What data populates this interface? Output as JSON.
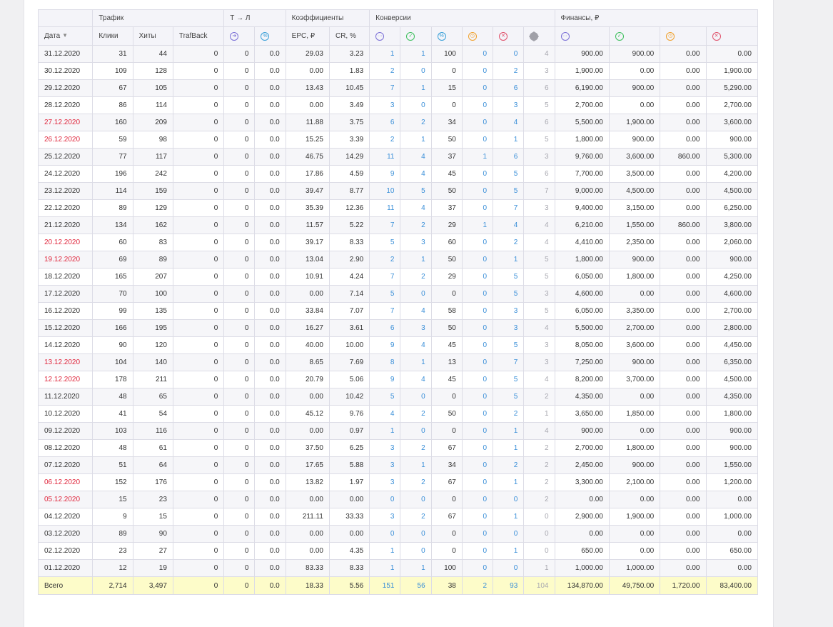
{
  "groups": {
    "traffic": "Трафик",
    "tl": "Т → Л",
    "coef": "Коэффициенты",
    "conv": "Конверсии",
    "fin": "Финансы, ₽"
  },
  "columns": {
    "date": "Дата",
    "clicks": "Клики",
    "hits": "Хиты",
    "trafback": "TrafBack",
    "epc": "EPC, ₽",
    "cr": "CR, %"
  },
  "icons": {
    "tl_arrow": "arrow-right-circle-icon",
    "tl_percent": "percent-circle-icon",
    "conv_all": "dots-circle-icon",
    "conv_approved": "check-circle-icon",
    "conv_percent": "percent-circle-icon",
    "conv_hold": "clock-circle-icon",
    "conv_rejected": "x-circle-icon",
    "conv_trash": "slash-circle-icon",
    "fin_all": "dots-circle-icon",
    "fin_approved": "check-circle-icon",
    "fin_hold": "clock-circle-icon",
    "fin_rejected": "x-circle-icon"
  },
  "colors": {
    "weekend": "#e0283e",
    "link": "#3a8fd8",
    "total_bg": "#fdfcc9"
  },
  "rows": [
    {
      "date": "31.12.2020",
      "weekend": false,
      "clicks": "31",
      "hits": "44",
      "trafback": "0",
      "tl_count": "0",
      "tl_pct": "0.0",
      "epc": "29.03",
      "cr": "3.23",
      "c_all": "1",
      "c_ok": "1",
      "c_pct": "100",
      "c_hold": "0",
      "c_rej": "0",
      "c_trash": "4",
      "f_all": "900.00",
      "f_ok": "900.00",
      "f_hold": "0.00",
      "f_rej": "0.00"
    },
    {
      "date": "30.12.2020",
      "weekend": false,
      "clicks": "109",
      "hits": "128",
      "trafback": "0",
      "tl_count": "0",
      "tl_pct": "0.0",
      "epc": "0.00",
      "cr": "1.83",
      "c_all": "2",
      "c_ok": "0",
      "c_pct": "0",
      "c_hold": "0",
      "c_rej": "2",
      "c_trash": "3",
      "f_all": "1,900.00",
      "f_ok": "0.00",
      "f_hold": "0.00",
      "f_rej": "1,900.00"
    },
    {
      "date": "29.12.2020",
      "weekend": false,
      "clicks": "67",
      "hits": "105",
      "trafback": "0",
      "tl_count": "0",
      "tl_pct": "0.0",
      "epc": "13.43",
      "cr": "10.45",
      "c_all": "7",
      "c_ok": "1",
      "c_pct": "15",
      "c_hold": "0",
      "c_rej": "6",
      "c_trash": "6",
      "f_all": "6,190.00",
      "f_ok": "900.00",
      "f_hold": "0.00",
      "f_rej": "5,290.00"
    },
    {
      "date": "28.12.2020",
      "weekend": false,
      "clicks": "86",
      "hits": "114",
      "trafback": "0",
      "tl_count": "0",
      "tl_pct": "0.0",
      "epc": "0.00",
      "cr": "3.49",
      "c_all": "3",
      "c_ok": "0",
      "c_pct": "0",
      "c_hold": "0",
      "c_rej": "3",
      "c_trash": "5",
      "f_all": "2,700.00",
      "f_ok": "0.00",
      "f_hold": "0.00",
      "f_rej": "2,700.00"
    },
    {
      "date": "27.12.2020",
      "weekend": true,
      "clicks": "160",
      "hits": "209",
      "trafback": "0",
      "tl_count": "0",
      "tl_pct": "0.0",
      "epc": "11.88",
      "cr": "3.75",
      "c_all": "6",
      "c_ok": "2",
      "c_pct": "34",
      "c_hold": "0",
      "c_rej": "4",
      "c_trash": "6",
      "f_all": "5,500.00",
      "f_ok": "1,900.00",
      "f_hold": "0.00",
      "f_rej": "3,600.00"
    },
    {
      "date": "26.12.2020",
      "weekend": true,
      "clicks": "59",
      "hits": "98",
      "trafback": "0",
      "tl_count": "0",
      "tl_pct": "0.0",
      "epc": "15.25",
      "cr": "3.39",
      "c_all": "2",
      "c_ok": "1",
      "c_pct": "50",
      "c_hold": "0",
      "c_rej": "1",
      "c_trash": "5",
      "f_all": "1,800.00",
      "f_ok": "900.00",
      "f_hold": "0.00",
      "f_rej": "900.00"
    },
    {
      "date": "25.12.2020",
      "weekend": false,
      "clicks": "77",
      "hits": "117",
      "trafback": "0",
      "tl_count": "0",
      "tl_pct": "0.0",
      "epc": "46.75",
      "cr": "14.29",
      "c_all": "11",
      "c_ok": "4",
      "c_pct": "37",
      "c_hold": "1",
      "c_rej": "6",
      "c_trash": "3",
      "f_all": "9,760.00",
      "f_ok": "3,600.00",
      "f_hold": "860.00",
      "f_rej": "5,300.00"
    },
    {
      "date": "24.12.2020",
      "weekend": false,
      "clicks": "196",
      "hits": "242",
      "trafback": "0",
      "tl_count": "0",
      "tl_pct": "0.0",
      "epc": "17.86",
      "cr": "4.59",
      "c_all": "9",
      "c_ok": "4",
      "c_pct": "45",
      "c_hold": "0",
      "c_rej": "5",
      "c_trash": "6",
      "f_all": "7,700.00",
      "f_ok": "3,500.00",
      "f_hold": "0.00",
      "f_rej": "4,200.00"
    },
    {
      "date": "23.12.2020",
      "weekend": false,
      "clicks": "114",
      "hits": "159",
      "trafback": "0",
      "tl_count": "0",
      "tl_pct": "0.0",
      "epc": "39.47",
      "cr": "8.77",
      "c_all": "10",
      "c_ok": "5",
      "c_pct": "50",
      "c_hold": "0",
      "c_rej": "5",
      "c_trash": "7",
      "f_all": "9,000.00",
      "f_ok": "4,500.00",
      "f_hold": "0.00",
      "f_rej": "4,500.00"
    },
    {
      "date": "22.12.2020",
      "weekend": false,
      "clicks": "89",
      "hits": "129",
      "trafback": "0",
      "tl_count": "0",
      "tl_pct": "0.0",
      "epc": "35.39",
      "cr": "12.36",
      "c_all": "11",
      "c_ok": "4",
      "c_pct": "37",
      "c_hold": "0",
      "c_rej": "7",
      "c_trash": "3",
      "f_all": "9,400.00",
      "f_ok": "3,150.00",
      "f_hold": "0.00",
      "f_rej": "6,250.00"
    },
    {
      "date": "21.12.2020",
      "weekend": false,
      "clicks": "134",
      "hits": "162",
      "trafback": "0",
      "tl_count": "0",
      "tl_pct": "0.0",
      "epc": "11.57",
      "cr": "5.22",
      "c_all": "7",
      "c_ok": "2",
      "c_pct": "29",
      "c_hold": "1",
      "c_rej": "4",
      "c_trash": "4",
      "f_all": "6,210.00",
      "f_ok": "1,550.00",
      "f_hold": "860.00",
      "f_rej": "3,800.00"
    },
    {
      "date": "20.12.2020",
      "weekend": true,
      "clicks": "60",
      "hits": "83",
      "trafback": "0",
      "tl_count": "0",
      "tl_pct": "0.0",
      "epc": "39.17",
      "cr": "8.33",
      "c_all": "5",
      "c_ok": "3",
      "c_pct": "60",
      "c_hold": "0",
      "c_rej": "2",
      "c_trash": "4",
      "f_all": "4,410.00",
      "f_ok": "2,350.00",
      "f_hold": "0.00",
      "f_rej": "2,060.00"
    },
    {
      "date": "19.12.2020",
      "weekend": true,
      "clicks": "69",
      "hits": "89",
      "trafback": "0",
      "tl_count": "0",
      "tl_pct": "0.0",
      "epc": "13.04",
      "cr": "2.90",
      "c_all": "2",
      "c_ok": "1",
      "c_pct": "50",
      "c_hold": "0",
      "c_rej": "1",
      "c_trash": "5",
      "f_all": "1,800.00",
      "f_ok": "900.00",
      "f_hold": "0.00",
      "f_rej": "900.00"
    },
    {
      "date": "18.12.2020",
      "weekend": false,
      "clicks": "165",
      "hits": "207",
      "trafback": "0",
      "tl_count": "0",
      "tl_pct": "0.0",
      "epc": "10.91",
      "cr": "4.24",
      "c_all": "7",
      "c_ok": "2",
      "c_pct": "29",
      "c_hold": "0",
      "c_rej": "5",
      "c_trash": "5",
      "f_all": "6,050.00",
      "f_ok": "1,800.00",
      "f_hold": "0.00",
      "f_rej": "4,250.00"
    },
    {
      "date": "17.12.2020",
      "weekend": false,
      "clicks": "70",
      "hits": "100",
      "trafback": "0",
      "tl_count": "0",
      "tl_pct": "0.0",
      "epc": "0.00",
      "cr": "7.14",
      "c_all": "5",
      "c_ok": "0",
      "c_pct": "0",
      "c_hold": "0",
      "c_rej": "5",
      "c_trash": "3",
      "f_all": "4,600.00",
      "f_ok": "0.00",
      "f_hold": "0.00",
      "f_rej": "4,600.00"
    },
    {
      "date": "16.12.2020",
      "weekend": false,
      "clicks": "99",
      "hits": "135",
      "trafback": "0",
      "tl_count": "0",
      "tl_pct": "0.0",
      "epc": "33.84",
      "cr": "7.07",
      "c_all": "7",
      "c_ok": "4",
      "c_pct": "58",
      "c_hold": "0",
      "c_rej": "3",
      "c_trash": "5",
      "f_all": "6,050.00",
      "f_ok": "3,350.00",
      "f_hold": "0.00",
      "f_rej": "2,700.00"
    },
    {
      "date": "15.12.2020",
      "weekend": false,
      "clicks": "166",
      "hits": "195",
      "trafback": "0",
      "tl_count": "0",
      "tl_pct": "0.0",
      "epc": "16.27",
      "cr": "3.61",
      "c_all": "6",
      "c_ok": "3",
      "c_pct": "50",
      "c_hold": "0",
      "c_rej": "3",
      "c_trash": "4",
      "f_all": "5,500.00",
      "f_ok": "2,700.00",
      "f_hold": "0.00",
      "f_rej": "2,800.00"
    },
    {
      "date": "14.12.2020",
      "weekend": false,
      "clicks": "90",
      "hits": "120",
      "trafback": "0",
      "tl_count": "0",
      "tl_pct": "0.0",
      "epc": "40.00",
      "cr": "10.00",
      "c_all": "9",
      "c_ok": "4",
      "c_pct": "45",
      "c_hold": "0",
      "c_rej": "5",
      "c_trash": "3",
      "f_all": "8,050.00",
      "f_ok": "3,600.00",
      "f_hold": "0.00",
      "f_rej": "4,450.00"
    },
    {
      "date": "13.12.2020",
      "weekend": true,
      "clicks": "104",
      "hits": "140",
      "trafback": "0",
      "tl_count": "0",
      "tl_pct": "0.0",
      "epc": "8.65",
      "cr": "7.69",
      "c_all": "8",
      "c_ok": "1",
      "c_pct": "13",
      "c_hold": "0",
      "c_rej": "7",
      "c_trash": "3",
      "f_all": "7,250.00",
      "f_ok": "900.00",
      "f_hold": "0.00",
      "f_rej": "6,350.00"
    },
    {
      "date": "12.12.2020",
      "weekend": true,
      "clicks": "178",
      "hits": "211",
      "trafback": "0",
      "tl_count": "0",
      "tl_pct": "0.0",
      "epc": "20.79",
      "cr": "5.06",
      "c_all": "9",
      "c_ok": "4",
      "c_pct": "45",
      "c_hold": "0",
      "c_rej": "5",
      "c_trash": "4",
      "f_all": "8,200.00",
      "f_ok": "3,700.00",
      "f_hold": "0.00",
      "f_rej": "4,500.00"
    },
    {
      "date": "11.12.2020",
      "weekend": false,
      "clicks": "48",
      "hits": "65",
      "trafback": "0",
      "tl_count": "0",
      "tl_pct": "0.0",
      "epc": "0.00",
      "cr": "10.42",
      "c_all": "5",
      "c_ok": "0",
      "c_pct": "0",
      "c_hold": "0",
      "c_rej": "5",
      "c_trash": "2",
      "f_all": "4,350.00",
      "f_ok": "0.00",
      "f_hold": "0.00",
      "f_rej": "4,350.00"
    },
    {
      "date": "10.12.2020",
      "weekend": false,
      "clicks": "41",
      "hits": "54",
      "trafback": "0",
      "tl_count": "0",
      "tl_pct": "0.0",
      "epc": "45.12",
      "cr": "9.76",
      "c_all": "4",
      "c_ok": "2",
      "c_pct": "50",
      "c_hold": "0",
      "c_rej": "2",
      "c_trash": "1",
      "f_all": "3,650.00",
      "f_ok": "1,850.00",
      "f_hold": "0.00",
      "f_rej": "1,800.00"
    },
    {
      "date": "09.12.2020",
      "weekend": false,
      "clicks": "103",
      "hits": "116",
      "trafback": "0",
      "tl_count": "0",
      "tl_pct": "0.0",
      "epc": "0.00",
      "cr": "0.97",
      "c_all": "1",
      "c_ok": "0",
      "c_pct": "0",
      "c_hold": "0",
      "c_rej": "1",
      "c_trash": "4",
      "f_all": "900.00",
      "f_ok": "0.00",
      "f_hold": "0.00",
      "f_rej": "900.00"
    },
    {
      "date": "08.12.2020",
      "weekend": false,
      "clicks": "48",
      "hits": "61",
      "trafback": "0",
      "tl_count": "0",
      "tl_pct": "0.0",
      "epc": "37.50",
      "cr": "6.25",
      "c_all": "3",
      "c_ok": "2",
      "c_pct": "67",
      "c_hold": "0",
      "c_rej": "1",
      "c_trash": "2",
      "f_all": "2,700.00",
      "f_ok": "1,800.00",
      "f_hold": "0.00",
      "f_rej": "900.00"
    },
    {
      "date": "07.12.2020",
      "weekend": false,
      "clicks": "51",
      "hits": "64",
      "trafback": "0",
      "tl_count": "0",
      "tl_pct": "0.0",
      "epc": "17.65",
      "cr": "5.88",
      "c_all": "3",
      "c_ok": "1",
      "c_pct": "34",
      "c_hold": "0",
      "c_rej": "2",
      "c_trash": "2",
      "f_all": "2,450.00",
      "f_ok": "900.00",
      "f_hold": "0.00",
      "f_rej": "1,550.00"
    },
    {
      "date": "06.12.2020",
      "weekend": true,
      "clicks": "152",
      "hits": "176",
      "trafback": "0",
      "tl_count": "0",
      "tl_pct": "0.0",
      "epc": "13.82",
      "cr": "1.97",
      "c_all": "3",
      "c_ok": "2",
      "c_pct": "67",
      "c_hold": "0",
      "c_rej": "1",
      "c_trash": "2",
      "f_all": "3,300.00",
      "f_ok": "2,100.00",
      "f_hold": "0.00",
      "f_rej": "1,200.00"
    },
    {
      "date": "05.12.2020",
      "weekend": true,
      "clicks": "15",
      "hits": "23",
      "trafback": "0",
      "tl_count": "0",
      "tl_pct": "0.0",
      "epc": "0.00",
      "cr": "0.00",
      "c_all": "0",
      "c_ok": "0",
      "c_pct": "0",
      "c_hold": "0",
      "c_rej": "0",
      "c_trash": "2",
      "f_all": "0.00",
      "f_ok": "0.00",
      "f_hold": "0.00",
      "f_rej": "0.00"
    },
    {
      "date": "04.12.2020",
      "weekend": false,
      "clicks": "9",
      "hits": "15",
      "trafback": "0",
      "tl_count": "0",
      "tl_pct": "0.0",
      "epc": "211.11",
      "cr": "33.33",
      "c_all": "3",
      "c_ok": "2",
      "c_pct": "67",
      "c_hold": "0",
      "c_rej": "1",
      "c_trash": "0",
      "f_all": "2,900.00",
      "f_ok": "1,900.00",
      "f_hold": "0.00",
      "f_rej": "1,000.00"
    },
    {
      "date": "03.12.2020",
      "weekend": false,
      "clicks": "89",
      "hits": "90",
      "trafback": "0",
      "tl_count": "0",
      "tl_pct": "0.0",
      "epc": "0.00",
      "cr": "0.00",
      "c_all": "0",
      "c_ok": "0",
      "c_pct": "0",
      "c_hold": "0",
      "c_rej": "0",
      "c_trash": "0",
      "f_all": "0.00",
      "f_ok": "0.00",
      "f_hold": "0.00",
      "f_rej": "0.00"
    },
    {
      "date": "02.12.2020",
      "weekend": false,
      "clicks": "23",
      "hits": "27",
      "trafback": "0",
      "tl_count": "0",
      "tl_pct": "0.0",
      "epc": "0.00",
      "cr": "4.35",
      "c_all": "1",
      "c_ok": "0",
      "c_pct": "0",
      "c_hold": "0",
      "c_rej": "1",
      "c_trash": "0",
      "f_all": "650.00",
      "f_ok": "0.00",
      "f_hold": "0.00",
      "f_rej": "650.00"
    },
    {
      "date": "01.12.2020",
      "weekend": false,
      "clicks": "12",
      "hits": "19",
      "trafback": "0",
      "tl_count": "0",
      "tl_pct": "0.0",
      "epc": "83.33",
      "cr": "8.33",
      "c_all": "1",
      "c_ok": "1",
      "c_pct": "100",
      "c_hold": "0",
      "c_rej": "0",
      "c_trash": "1",
      "f_all": "1,000.00",
      "f_ok": "1,000.00",
      "f_hold": "0.00",
      "f_rej": "0.00"
    }
  ],
  "total": {
    "label": "Всего",
    "clicks": "2,714",
    "hits": "3,497",
    "trafback": "0",
    "tl_count": "0",
    "tl_pct": "0.0",
    "epc": "18.33",
    "cr": "5.56",
    "c_all": "151",
    "c_ok": "56",
    "c_pct": "38",
    "c_hold": "2",
    "c_rej": "93",
    "c_trash": "104",
    "f_all": "134,870.00",
    "f_ok": "49,750.00",
    "f_hold": "1,720.00",
    "f_rej": "83,400.00"
  }
}
